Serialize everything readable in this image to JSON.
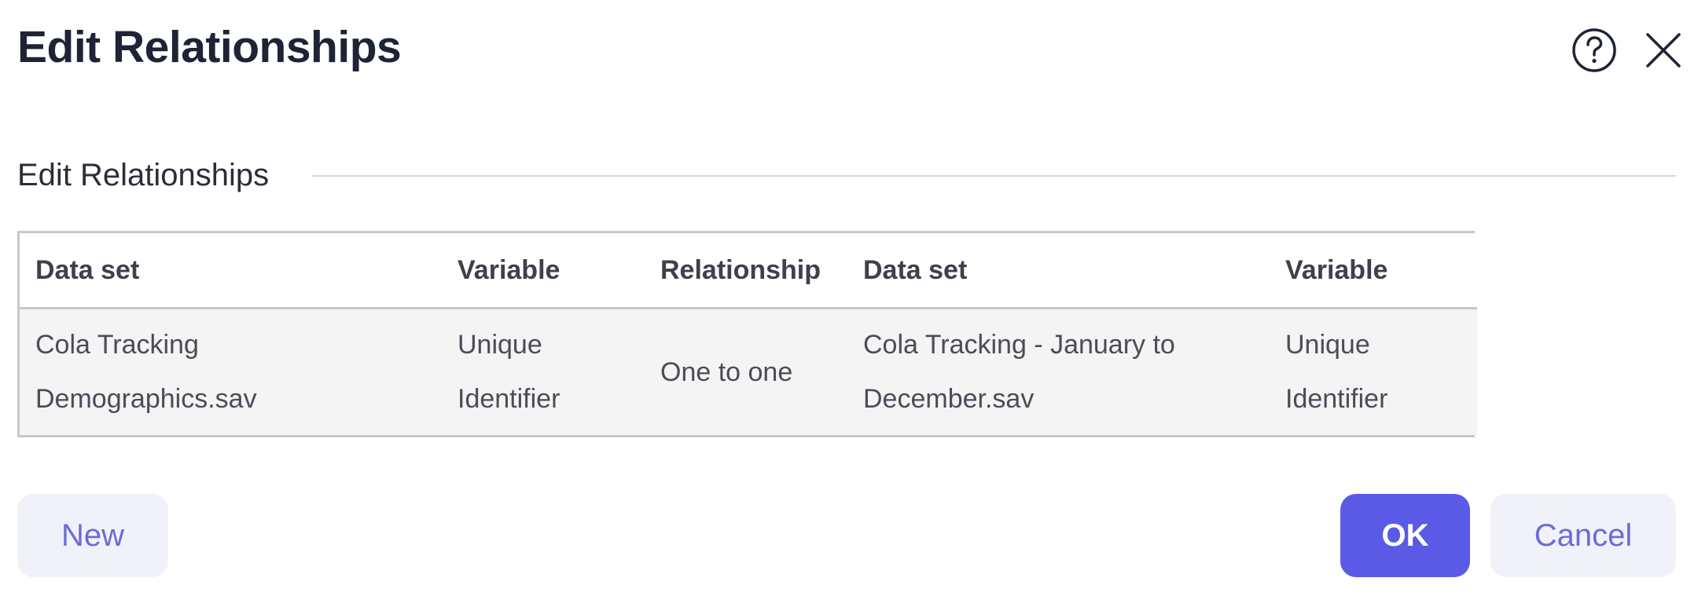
{
  "dialog": {
    "title": "Edit Relationships",
    "help_icon": "help-circle-icon",
    "close_icon": "close-icon"
  },
  "section": {
    "title": "Edit Relationships"
  },
  "table": {
    "headers": [
      "Data set",
      "Variable",
      "Relationship",
      "Data set",
      "Variable"
    ],
    "rows": [
      {
        "dataset_left": "Cola Tracking Demographics.sav",
        "variable_left": "Unique Identifier",
        "relationship": "One to one",
        "dataset_right": "Cola Tracking - January to December.sav",
        "variable_right": "Unique Identifier"
      }
    ]
  },
  "buttons": {
    "new_label": "New",
    "ok_label": "OK",
    "cancel_label": "Cancel"
  },
  "colors": {
    "accent": "#5a5ae6",
    "secondary_button_bg": "#f1f2f9",
    "secondary_button_text": "#6a6cd6",
    "row_bg": "#f4f4f4",
    "border": "#c8c8c8"
  }
}
